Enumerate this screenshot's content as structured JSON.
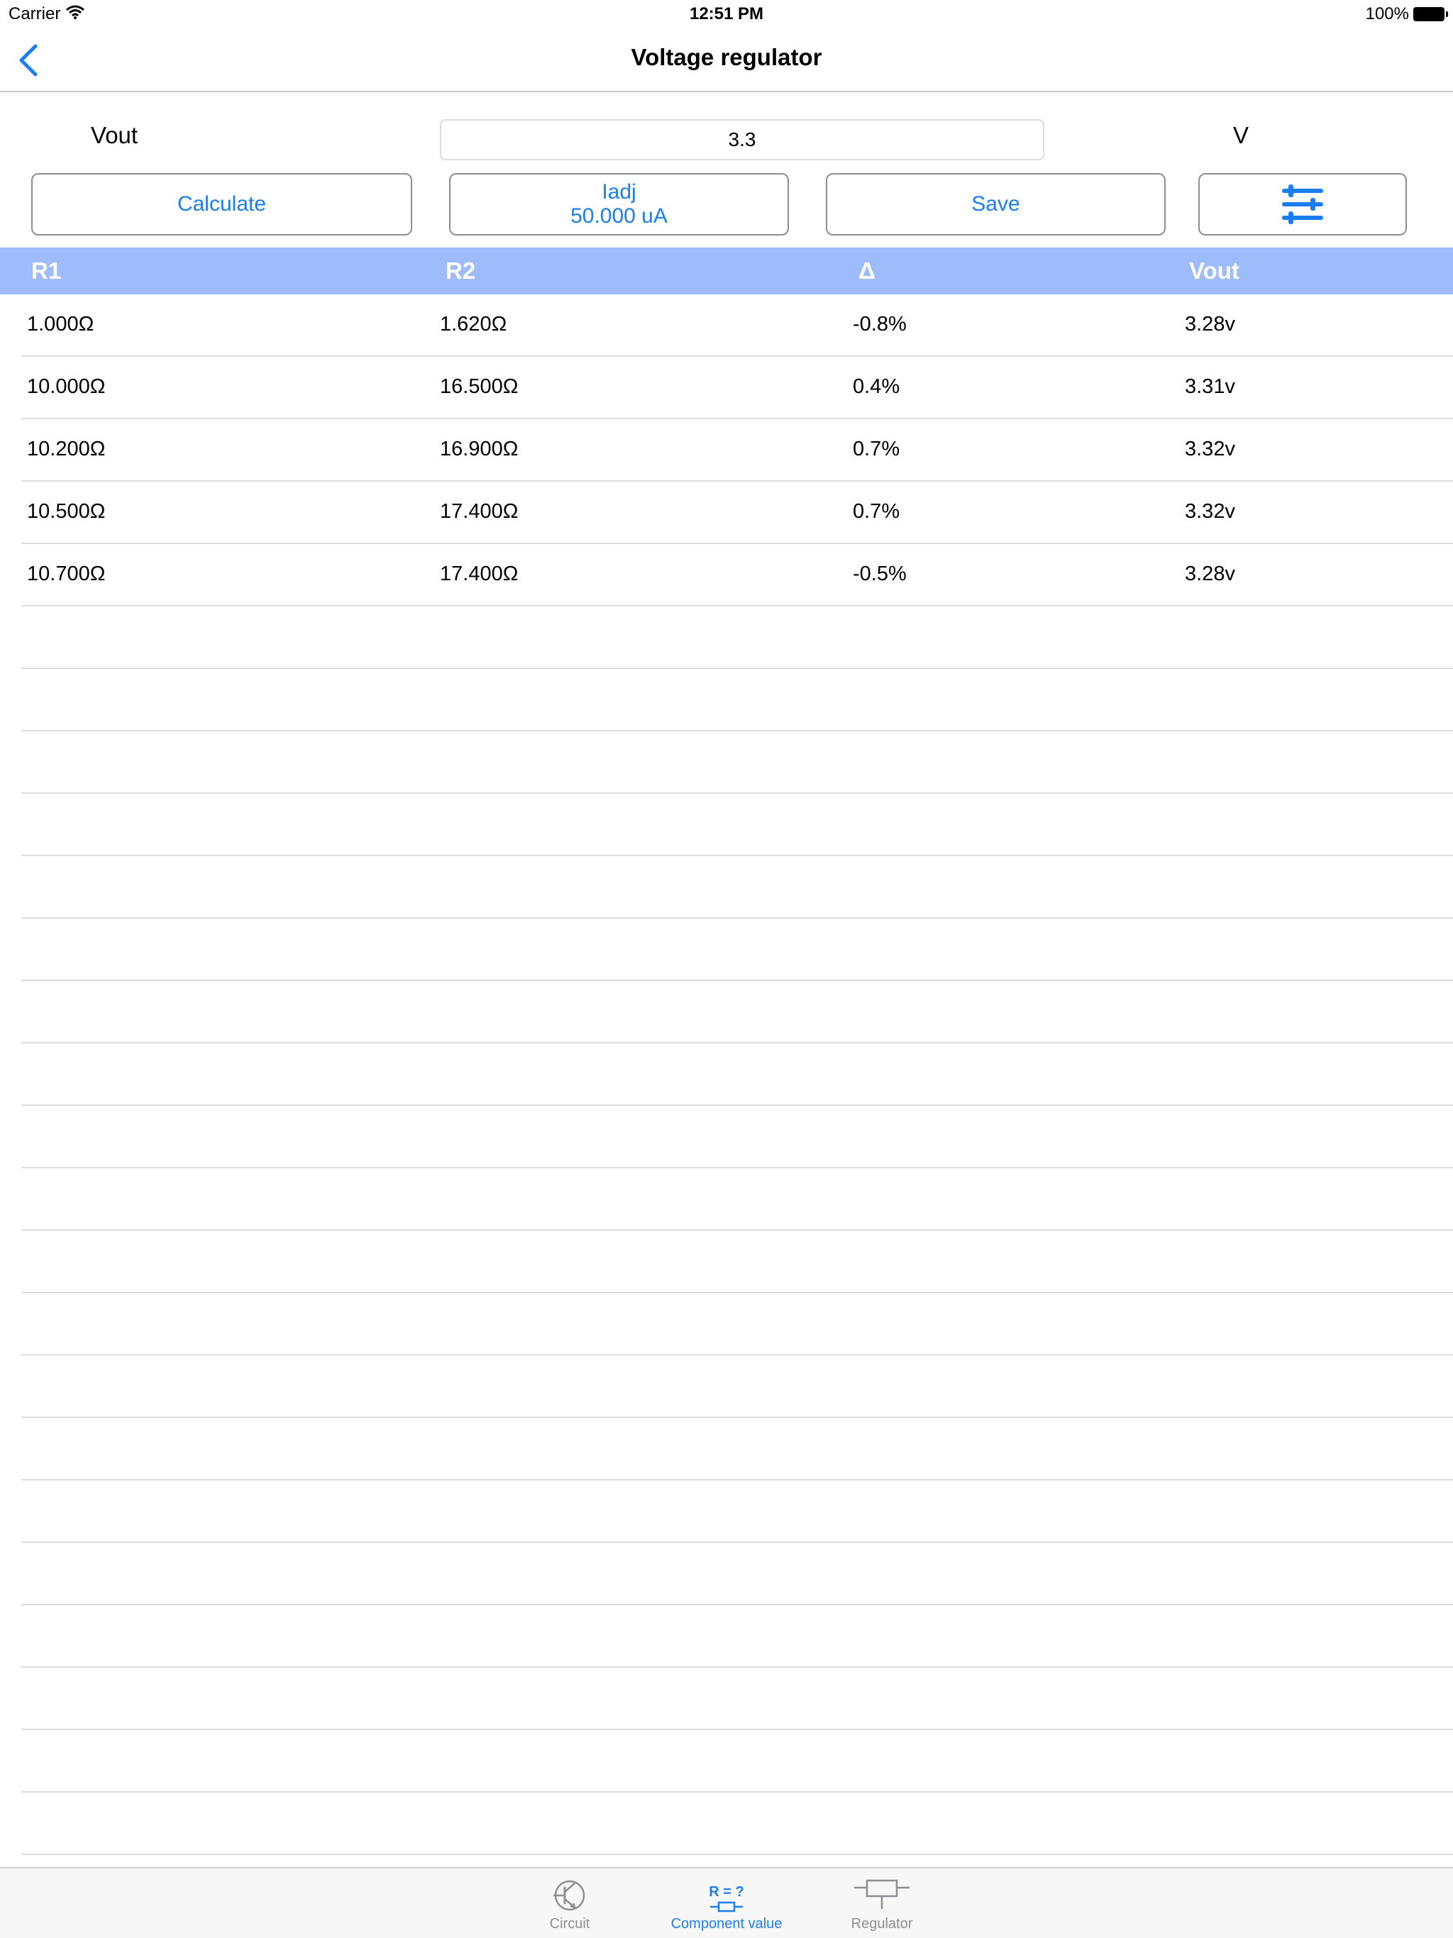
{
  "status_bar": {
    "carrier": "Carrier",
    "time": "12:51 PM",
    "battery": "100%"
  },
  "nav": {
    "title": "Voltage regulator"
  },
  "form": {
    "vout_label": "Vout",
    "vout_value": "3.3",
    "unit": "V"
  },
  "buttons": {
    "calculate": "Calculate",
    "iadj_label": "Iadj",
    "iadj_value": "50.000 uA",
    "save": "Save"
  },
  "table": {
    "headers": [
      "R1",
      "R2",
      "Δ",
      "Vout"
    ],
    "rows": [
      [
        "1.000Ω",
        "1.620Ω",
        "-0.8%",
        "3.28v"
      ],
      [
        "10.000Ω",
        "16.500Ω",
        "0.4%",
        "3.31v"
      ],
      [
        "10.200Ω",
        "16.900Ω",
        "0.7%",
        "3.32v"
      ],
      [
        "10.500Ω",
        "17.400Ω",
        "0.7%",
        "3.32v"
      ],
      [
        "10.700Ω",
        "17.400Ω",
        "-0.5%",
        "3.28v"
      ]
    ]
  },
  "tabs": [
    {
      "label": "Circuit",
      "icon": "transistor-icon"
    },
    {
      "label": "Component value",
      "icon": "resistor-value-icon",
      "icon_text": "R = ?"
    },
    {
      "label": "Regulator",
      "icon": "regulator-icon"
    }
  ],
  "colors": {
    "accent": "#1a7ef0",
    "header_bg": "#9ebcfb",
    "tab_inactive": "#8e8e93"
  }
}
